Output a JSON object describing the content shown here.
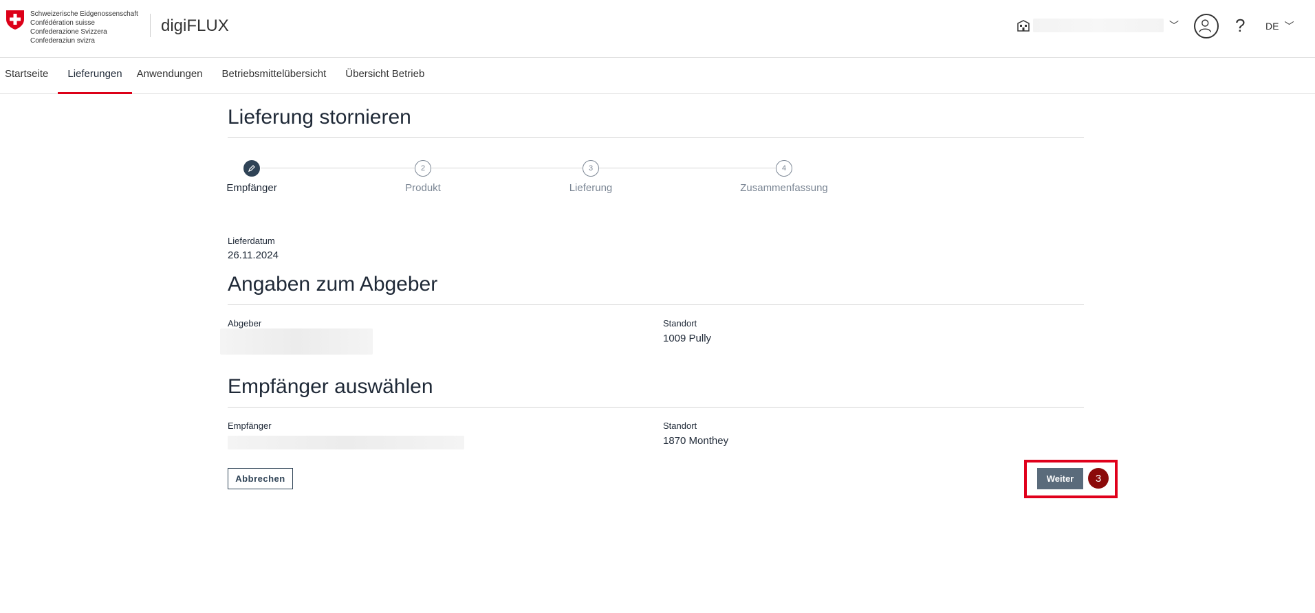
{
  "header": {
    "confederation_lines": [
      "Schweizerische Eidgenossenschaft",
      "Confédération suisse",
      "Confederazione Svizzera",
      "Confederaziun svizra"
    ],
    "app_name": "digiFLUX",
    "language": "DE"
  },
  "nav": {
    "items": [
      {
        "label": "Startseite"
      },
      {
        "label": "Lieferungen"
      },
      {
        "label": "Anwendungen"
      },
      {
        "label": "Betriebsmittelübersicht"
      },
      {
        "label": "Übersicht Betrieb"
      }
    ]
  },
  "page": {
    "title": "Lieferung stornieren"
  },
  "stepper": {
    "steps": [
      {
        "number": "",
        "label": "Empfänger"
      },
      {
        "number": "2",
        "label": "Produkt"
      },
      {
        "number": "3",
        "label": "Lieferung"
      },
      {
        "number": "4",
        "label": "Zusammenfassung"
      }
    ]
  },
  "delivery": {
    "date_label": "Lieferdatum",
    "date_value": "26.11.2024"
  },
  "sender_section": {
    "title": "Angaben zum Abgeber",
    "sender_label": "Abgeber",
    "location_label": "Standort",
    "location_value": "1009 Pully"
  },
  "recipient_section": {
    "title": "Empfänger auswählen",
    "recipient_label": "Empfänger",
    "location_label": "Standort",
    "location_value": "1870 Monthey"
  },
  "actions": {
    "cancel_label": "Abbrechen",
    "next_label": "Weiter",
    "badge": "3"
  },
  "colors": {
    "accent_red": "#dc0018",
    "primary": "#2f4356",
    "button": "#5a6b7b",
    "badge": "#8b0a0a"
  }
}
